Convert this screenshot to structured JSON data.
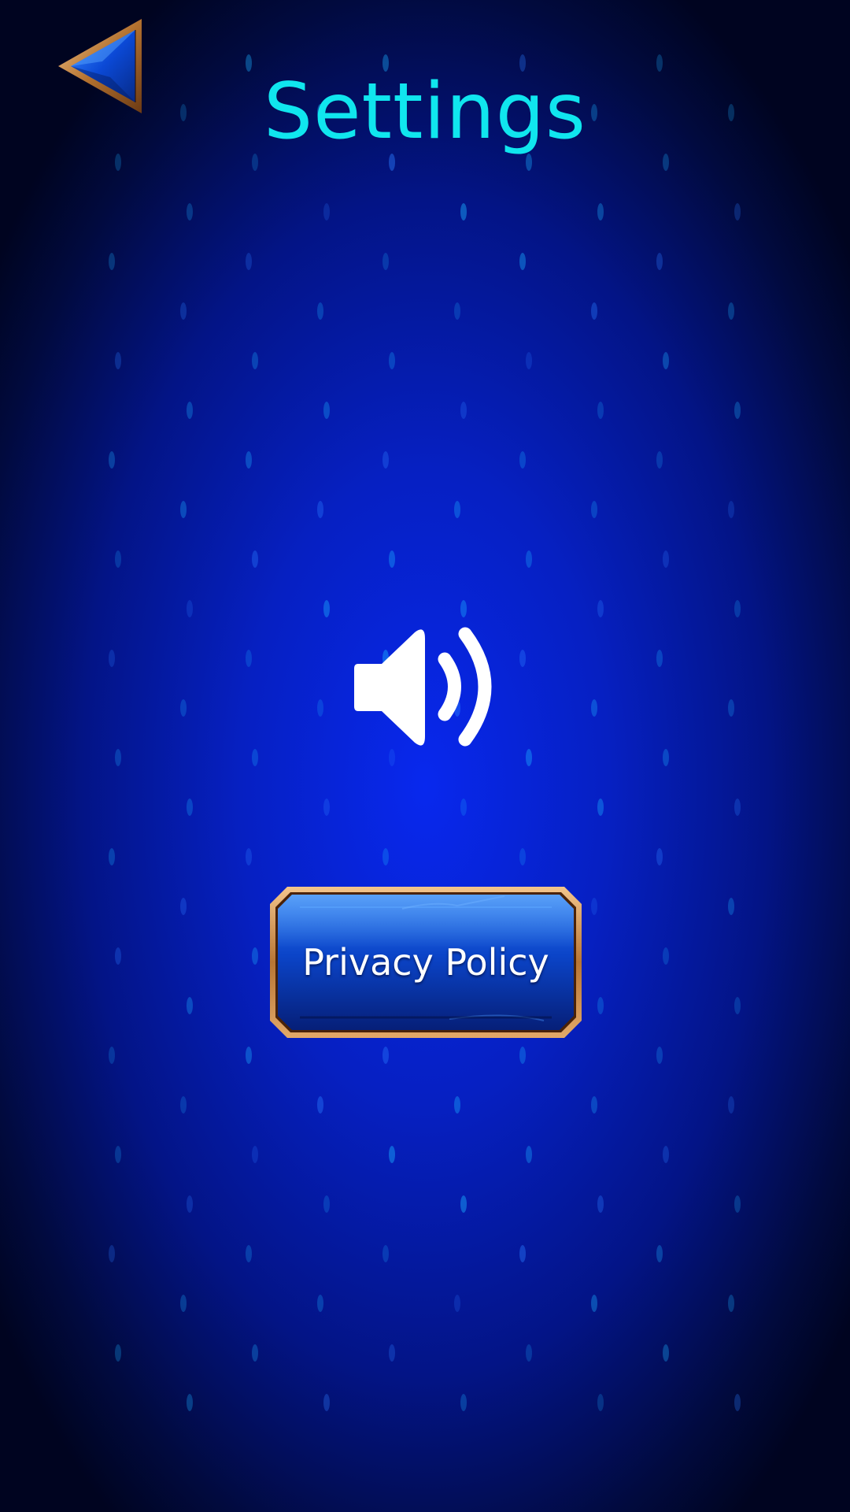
{
  "screen": {
    "title": "Settings"
  },
  "header": {
    "back_icon": "back-arrow-icon"
  },
  "sound": {
    "icon": "speaker-volume-icon",
    "state": "on"
  },
  "privacy": {
    "label": "Privacy Policy"
  },
  "colors": {
    "title": "#10e6ee",
    "background_center": "#0828ee",
    "background_edge": "#000420",
    "button_frame": "#c98a4a",
    "button_face": "#0a3fc0"
  }
}
